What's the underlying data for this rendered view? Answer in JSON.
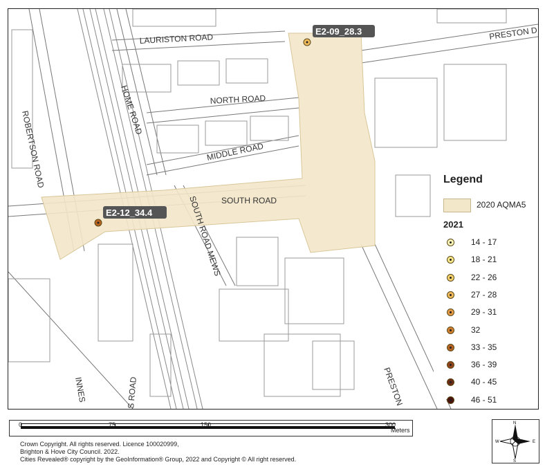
{
  "roads": {
    "lauriston": "LAURISTON ROAD",
    "preston_d": "PRESTON D",
    "home": "HOME ROAD",
    "north": "NORTH ROAD",
    "middle": "MIDDLE ROAD",
    "robertson": "ROBERTSON ROAD",
    "south": "SOUTH ROAD",
    "south_mews": "SOUTH ROAD MEWS",
    "preston": "PRESTON",
    "s_road": "S ROAD",
    "innes": "INNES"
  },
  "sites": [
    {
      "id": "E2-09",
      "value": 28.3,
      "label": "E2-09_28.3"
    },
    {
      "id": "E2-12",
      "value": 34.4,
      "label": "E2-12_34.4"
    }
  ],
  "legend": {
    "title": "Legend",
    "aqma_label": "2020 AQMA5",
    "aqma_color": "#f3e7c9",
    "year": "2021",
    "classes": [
      {
        "range": "14 - 17",
        "color": "#fff7b8"
      },
      {
        "range": "18 - 21",
        "color": "#fde98a"
      },
      {
        "range": "22 - 26",
        "color": "#f7d169"
      },
      {
        "range": "27 - 28",
        "color": "#f0b95a"
      },
      {
        "range": "29 - 31",
        "color": "#e59a45"
      },
      {
        "range": "32",
        "color": "#d2802f"
      },
      {
        "range": "33 - 35",
        "color": "#b86322"
      },
      {
        "range": "36 - 39",
        "color": "#93441a"
      },
      {
        "range": "40 - 45",
        "color": "#6b2a12"
      },
      {
        "range": "46 - 51",
        "color": "#4a120a"
      }
    ]
  },
  "scale": {
    "ticks": [
      "0",
      "75",
      "150",
      "300"
    ],
    "unit": "Meters"
  },
  "credits": [
    "Crown Copyright. All rights reserved. Licence 100020999,",
    "Brighton & Hove City Council. 2022.",
    "Cities Revealed® copyright by the GeoInformation® Group, 2022 and Copyright © All right reserved."
  ],
  "north_arrow": {
    "n": "N",
    "s": "S",
    "e": "E",
    "w": "W"
  }
}
